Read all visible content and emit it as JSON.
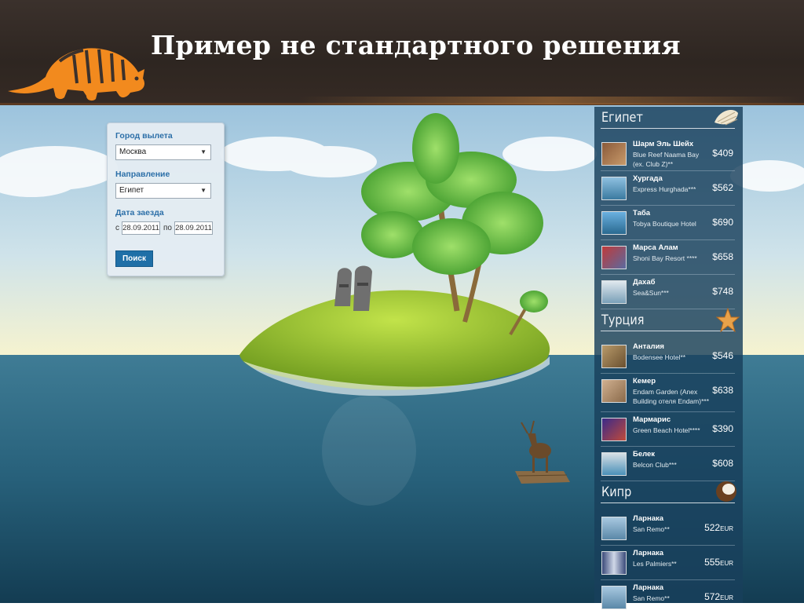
{
  "header": {
    "title": "Пример не стандартного решения"
  },
  "search": {
    "city_label": "Город вылета",
    "city_value": "Москва",
    "direction_label": "Направление",
    "direction_value": "Египет",
    "date_label": "Дата заезда",
    "from_label": "с",
    "from_date": "28.09.2011",
    "to_label": "по",
    "to_date": "28.09.2011",
    "search_button": "Поиск"
  },
  "panel": {
    "egypt": {
      "title": "Египет",
      "items": [
        {
          "name": "Шарм Эль Шейх",
          "hotel": "Blue Reef Naama Bay (ex. Club Z)**",
          "price": "$409"
        },
        {
          "name": "Хургада",
          "hotel": "Express Hurghada***",
          "price": "$562"
        },
        {
          "name": "Таба",
          "hotel": "Tobya Boutique Hotel",
          "price": "$690"
        },
        {
          "name": "Марса Алам",
          "hotel": "Shoni Bay Resort ****",
          "price": "$658"
        },
        {
          "name": "Дахаб",
          "hotel": "Sea&Sun***",
          "price": "$748"
        }
      ]
    },
    "turkey": {
      "title": "Турция",
      "items": [
        {
          "name": "Анталия",
          "hotel": "Bodensee Hotel**",
          "price": "$546"
        },
        {
          "name": "Кемер",
          "hotel": "Endam Garden (Anex Building отеля Endam)***",
          "price": "$638"
        },
        {
          "name": "Мармарис",
          "hotel": "Green Beach Hotel****",
          "price": "$390"
        },
        {
          "name": "Белек",
          "hotel": "Belcon Club***",
          "price": "$608"
        }
      ]
    },
    "cyprus": {
      "title": "Кипр",
      "items": [
        {
          "name": "Ларнака",
          "hotel": "San Remo**",
          "price": "522",
          "currency": "EUR"
        },
        {
          "name": "Ларнака",
          "hotel": "Les Palmiers**",
          "price": "555",
          "currency": "EUR"
        },
        {
          "name": "Ларнака",
          "hotel": "San Remo**",
          "price": "572",
          "currency": "EUR"
        }
      ]
    }
  },
  "colors": {
    "header_bg": "#2e2621",
    "accent_blue": "#2c6fa8",
    "button_blue": "#1f6fa7",
    "logo_orange": "#f28a1e",
    "panel_bg": "#18405c"
  },
  "icons": [
    "armadillo-logo-icon",
    "seashell-icon",
    "starfish-icon",
    "coconut-icon",
    "palm-tree-icon",
    "moai-statue-icon",
    "deer-icon",
    "raft-icon"
  ]
}
